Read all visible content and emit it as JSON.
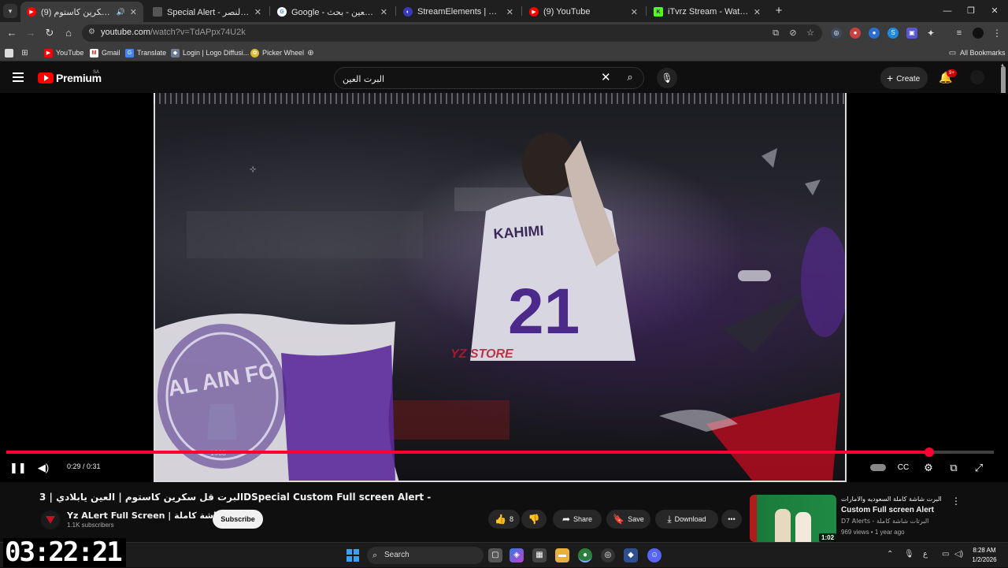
{
  "browser": {
    "tabs": [
      {
        "title": "البرت قل سكرين كاستوم (9)",
        "favicon": "youtube-icon",
        "active": true
      },
      {
        "title": "Special Alert - البرت نادي النصر",
        "favicon": "doc-icon",
        "active": false
      },
      {
        "title": "Google - البرت العين - بحث",
        "favicon": "google-icon",
        "active": false
      },
      {
        "title": "StreamElements | The Ultimate",
        "favicon": "streamelements-icon",
        "active": false
      },
      {
        "title": "(9) YouTube",
        "favicon": "youtube-icon",
        "active": false
      },
      {
        "title": "iTvrz Stream - Watch Live on K",
        "favicon": "kick-icon",
        "active": false
      }
    ],
    "url_host": "youtube.com",
    "url_path": "/watch?v=TdAPpx74U2k",
    "bookmarks": [
      {
        "label": "YouTube",
        "icon": "youtube-icon"
      },
      {
        "label": "Gmail",
        "icon": "gmail-icon"
      },
      {
        "label": "Translate",
        "icon": "translate-icon"
      },
      {
        "label": "Login | Logo Diffusi...",
        "icon": "logo-diffusion-icon"
      },
      {
        "label": "Picker Wheel",
        "icon": "picker-wheel-icon"
      }
    ],
    "all_bookmarks_label": "All Bookmarks"
  },
  "youtube": {
    "brand": "Premium",
    "country": "SA",
    "search_value": "البرت العين",
    "create_label": "Create",
    "notification_badge": "9+"
  },
  "player": {
    "time_current": "0:29",
    "time_total": "0:31",
    "progress": 0.935
  },
  "video": {
    "title": "البرت قل سكرين كاستوم | العين يابلادي | 3DSpecial Custom Full screen Alert -",
    "channel": "Yz ALert Full Screen | البرتات شاشة كاملة",
    "subscribers": "1.1K subscribers",
    "subscribe_label": "Subscribe",
    "likes": "8",
    "share_label": "Share",
    "save_label": "Save",
    "download_label": "Download"
  },
  "recommendation": {
    "title_ar": "البرت شاشة كاملة السعوديه والامارات",
    "title_en": "Custom Full screen Alert",
    "channel": "D7 Alerts - البرتات شاشة كاملة",
    "meta": "969 views • 1 year ago",
    "duration": "1:02"
  },
  "taskbar": {
    "search_placeholder": "Search",
    "time": "8:28 AM",
    "date": "1/2/2026"
  },
  "overlay_timer": "03:22:21"
}
